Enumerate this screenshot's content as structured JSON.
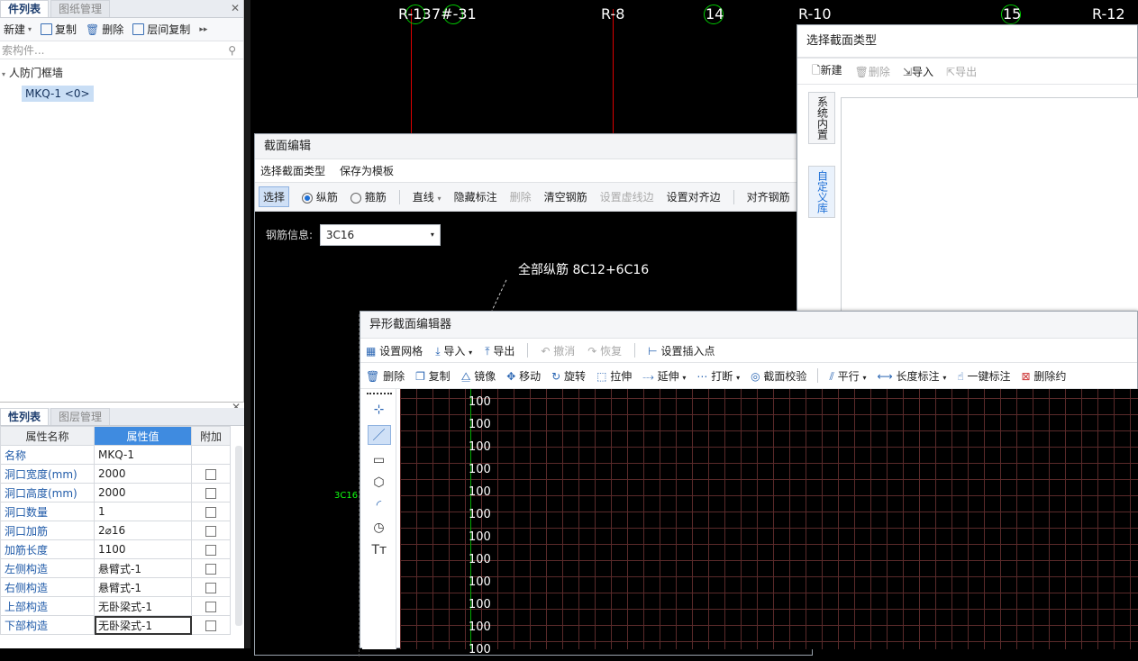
{
  "left_panel": {
    "top_tabs": [
      "件列表",
      "图纸管理"
    ],
    "toolbar": {
      "new": "新建",
      "copy": "复制",
      "delete": "删除",
      "floor_copy": "层间复制"
    },
    "search_placeholder": "索构件...",
    "tree_root": "人防门框墙",
    "tree_item": "MKQ-1 <0>",
    "bottom_tabs": [
      "性列表",
      "图层管理"
    ],
    "prop_headers": [
      "属性名称",
      "属性值",
      "附加"
    ],
    "props": [
      {
        "name": "名称",
        "value": "MKQ-1"
      },
      {
        "name": "洞口宽度(mm)",
        "value": "2000"
      },
      {
        "name": "洞口高度(mm)",
        "value": "2000"
      },
      {
        "name": "洞口数量",
        "value": "1"
      },
      {
        "name": "洞口加筋",
        "value": "2⌀16"
      },
      {
        "name": "加筋长度",
        "value": "1100"
      },
      {
        "name": "左侧构造",
        "value": "悬臂式-1"
      },
      {
        "name": "右侧构造",
        "value": "悬臂式-1"
      },
      {
        "name": "上部构造",
        "value": "无卧梁式-1"
      },
      {
        "name": "下部构造",
        "value": "无卧梁式-1"
      }
    ]
  },
  "cad": {
    "axis_labels": [
      "R-13",
      "7#-31",
      "R-8",
      "14",
      "R-10",
      "15",
      "R-12"
    ],
    "rebar_note": "全部纵筋  8C12+6C16",
    "ruler_value": "100",
    "side_label": "3C16"
  },
  "section_edit": {
    "title": "截面编辑",
    "menu": [
      "选择截面类型",
      "保存为模板"
    ],
    "toolbar": {
      "select": "选择",
      "longitudinal": "纵筋",
      "stirrup": "箍筋",
      "line": "直线",
      "hide_dim": "隐藏标注",
      "delete": "删除",
      "clear_rebar": "清空钢筋",
      "set_virtual": "设置虚线边",
      "set_align": "设置对齐边",
      "align_rebar": "对齐钢筋"
    },
    "rebar_info_label": "钢筋信息:",
    "rebar_info_value": "3C16"
  },
  "section_type": {
    "title": "选择截面类型",
    "toolbar": {
      "new": "新建",
      "delete": "删除",
      "import": "导入",
      "export": "导出"
    },
    "vtabs": [
      "系统内置",
      "自定义库"
    ]
  },
  "shape_editor": {
    "title": "异形截面编辑器",
    "toolbar1": {
      "grid": "设置网格",
      "import": "导入",
      "export": "导出",
      "undo": "撤消",
      "redo": "恢复",
      "insert_point": "设置插入点"
    },
    "toolbar2": {
      "delete": "删除",
      "copy": "复制",
      "mirror": "镜像",
      "move": "移动",
      "rotate": "旋转",
      "stretch": "拉伸",
      "extend": "延伸",
      "break": "打断",
      "check": "截面校验",
      "parallel": "平行",
      "length_dim": "长度标注",
      "one_dim": "一键标注",
      "delete_constraint": "删除约"
    },
    "row_labels": [
      "100",
      "100",
      "100",
      "100",
      "100",
      "100",
      "100",
      "100",
      "100",
      "100",
      "100",
      "100"
    ]
  }
}
